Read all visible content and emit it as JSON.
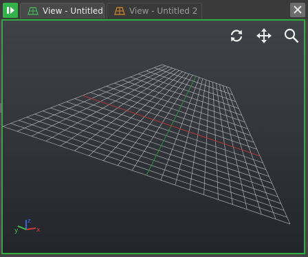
{
  "tabs": [
    {
      "label": "View - Untitled",
      "active": true,
      "icon": "viewport-icon",
      "icon_color": "#3fbf5a"
    },
    {
      "label": "View - Untitled 2",
      "active": false,
      "icon": "viewport-icon",
      "icon_color": "#d88a2a"
    }
  ],
  "panel_toggle": {
    "icon": "panel-toggle-icon",
    "color": "#33b24a"
  },
  "close_button": {
    "icon": "close-icon"
  },
  "viewport": {
    "border_color": "#2fae3f",
    "nav_tools": [
      {
        "name": "orbit-icon"
      },
      {
        "name": "pan-icon"
      },
      {
        "name": "zoom-icon"
      }
    ],
    "axis_gizmo": {
      "labels": {
        "x": "x",
        "y": "y",
        "z": "z"
      },
      "colors": {
        "x": "#d03b3b",
        "y": "#3cc24f",
        "z": "#3a66e0"
      }
    },
    "grid": {
      "cells": 20,
      "x_axis_color": "#b1373a",
      "z_axis_color": "#2b8f3a",
      "line_color": "#c8c8c8"
    }
  }
}
